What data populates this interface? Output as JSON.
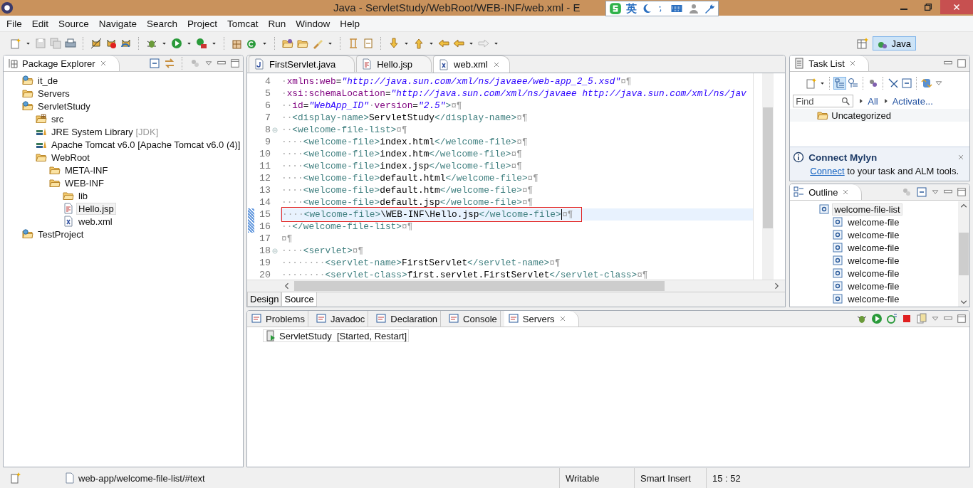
{
  "window": {
    "title": "Java - ServletStudy/WebRoot/WEB-INF/web.xml - E"
  },
  "input_method": {
    "mode": "英"
  },
  "menu": [
    "File",
    "Edit",
    "Source",
    "Navigate",
    "Search",
    "Project",
    "Tomcat",
    "Run",
    "Window",
    "Help"
  ],
  "perspective": {
    "label": "Java",
    "selected": true
  },
  "package_explorer": {
    "title": "Package Explorer",
    "items": [
      {
        "label": "it_de",
        "kind": "project",
        "selected": false
      },
      {
        "label": "Servers",
        "kind": "folder",
        "selected": false
      },
      {
        "label": "ServletStudy",
        "kind": "project",
        "selected": false,
        "children": [
          {
            "label": "src",
            "kind": "source",
            "selected": false
          },
          {
            "label": "JRE System Library",
            "decoration": "[JDK]",
            "kind": "library",
            "selected": false
          },
          {
            "label": "Apache Tomcat v6.0 [Apache Tomcat v6.0 (4)]",
            "kind": "library",
            "selected": false
          },
          {
            "label": "WebRoot",
            "kind": "folder",
            "selected": false,
            "children": [
              {
                "label": "META-INF",
                "kind": "folder",
                "selected": false
              },
              {
                "label": "WEB-INF",
                "kind": "folder",
                "selected": false,
                "children": [
                  {
                    "label": "lib",
                    "kind": "folder",
                    "selected": false
                  },
                  {
                    "label": "Hello.jsp",
                    "kind": "jsp",
                    "selected": true
                  },
                  {
                    "label": "web.xml",
                    "kind": "xml",
                    "selected": false
                  }
                ]
              }
            ]
          }
        ]
      },
      {
        "label": "TestProject",
        "kind": "project",
        "selected": false
      }
    ]
  },
  "editor": {
    "tabs": [
      {
        "label": "FirstServlet.java",
        "kind": "java",
        "selected": false
      },
      {
        "label": "Hello.jsp",
        "kind": "jsp",
        "selected": false
      },
      {
        "label": "web.xml",
        "kind": "xml",
        "selected": true
      }
    ],
    "lines": [
      {
        "number": "4",
        "foldable": false,
        "changed": false,
        "current": false,
        "boxed": false,
        "segments": [
          {
            "kind": "ws",
            "text": "·"
          },
          {
            "kind": "attr",
            "text": "xmlns:web"
          },
          {
            "kind": "plain",
            "text": "="
          },
          {
            "kind": "value",
            "text": "\"http://java.sun.com/xml/ns/javaee/web-app_2_5.xsd\""
          },
          {
            "kind": "mark",
            "text": "¤¶"
          }
        ]
      },
      {
        "number": "5",
        "foldable": false,
        "changed": false,
        "current": false,
        "boxed": false,
        "segments": [
          {
            "kind": "ws",
            "text": "·"
          },
          {
            "kind": "attr",
            "text": "xsi:schemaLocation"
          },
          {
            "kind": "plain",
            "text": "="
          },
          {
            "kind": "value",
            "text": "\"http://java.sun.com/xml/ns/javaee http://java.sun.com/xml/ns/jav"
          }
        ]
      },
      {
        "number": "6",
        "foldable": false,
        "changed": false,
        "current": false,
        "boxed": false,
        "segments": [
          {
            "kind": "ws",
            "text": "··"
          },
          {
            "kind": "attr",
            "text": "id"
          },
          {
            "kind": "plain",
            "text": "="
          },
          {
            "kind": "value",
            "text": "\"WebApp_ID\""
          },
          {
            "kind": "ws",
            "text": "·"
          },
          {
            "kind": "attr",
            "text": "version"
          },
          {
            "kind": "plain",
            "text": "="
          },
          {
            "kind": "value",
            "text": "\"2.5\""
          },
          {
            "kind": "tag",
            "text": ">"
          },
          {
            "kind": "mark",
            "text": "¤¶"
          }
        ]
      },
      {
        "number": "7",
        "foldable": false,
        "changed": false,
        "current": false,
        "boxed": false,
        "segments": [
          {
            "kind": "ws",
            "text": "··"
          },
          {
            "kind": "tag",
            "text": "<display-name>"
          },
          {
            "kind": "plain",
            "text": "ServletStudy"
          },
          {
            "kind": "tag",
            "text": "</display-name>"
          },
          {
            "kind": "mark",
            "text": "¤¶"
          }
        ]
      },
      {
        "number": "8",
        "foldable": true,
        "changed": false,
        "current": false,
        "boxed": false,
        "segments": [
          {
            "kind": "ws",
            "text": "··"
          },
          {
            "kind": "tag",
            "text": "<welcome-file-list>"
          },
          {
            "kind": "mark",
            "text": "¤¶"
          }
        ]
      },
      {
        "number": "9",
        "foldable": false,
        "changed": false,
        "current": false,
        "boxed": false,
        "segments": [
          {
            "kind": "ws",
            "text": "····"
          },
          {
            "kind": "tag",
            "text": "<welcome-file>"
          },
          {
            "kind": "plain",
            "text": "index.html"
          },
          {
            "kind": "tag",
            "text": "</welcome-file>"
          },
          {
            "kind": "mark",
            "text": "¤¶"
          }
        ]
      },
      {
        "number": "10",
        "foldable": false,
        "changed": false,
        "current": false,
        "boxed": false,
        "segments": [
          {
            "kind": "ws",
            "text": "····"
          },
          {
            "kind": "tag",
            "text": "<welcome-file>"
          },
          {
            "kind": "plain",
            "text": "index.htm"
          },
          {
            "kind": "tag",
            "text": "</welcome-file>"
          },
          {
            "kind": "mark",
            "text": "¤¶"
          }
        ]
      },
      {
        "number": "11",
        "foldable": false,
        "changed": false,
        "current": false,
        "boxed": false,
        "segments": [
          {
            "kind": "ws",
            "text": "····"
          },
          {
            "kind": "tag",
            "text": "<welcome-file>"
          },
          {
            "kind": "plain",
            "text": "index.jsp"
          },
          {
            "kind": "tag",
            "text": "</welcome-file>"
          },
          {
            "kind": "mark",
            "text": "¤¶"
          }
        ]
      },
      {
        "number": "12",
        "foldable": false,
        "changed": false,
        "current": false,
        "boxed": false,
        "segments": [
          {
            "kind": "ws",
            "text": "····"
          },
          {
            "kind": "tag",
            "text": "<welcome-file>"
          },
          {
            "kind": "plain",
            "text": "default.html"
          },
          {
            "kind": "tag",
            "text": "</welcome-file>"
          },
          {
            "kind": "mark",
            "text": "¤¶"
          }
        ]
      },
      {
        "number": "13",
        "foldable": false,
        "changed": false,
        "current": false,
        "boxed": false,
        "segments": [
          {
            "kind": "ws",
            "text": "····"
          },
          {
            "kind": "tag",
            "text": "<welcome-file>"
          },
          {
            "kind": "plain",
            "text": "default.htm"
          },
          {
            "kind": "tag",
            "text": "</welcome-file>"
          },
          {
            "kind": "mark",
            "text": "¤¶"
          }
        ]
      },
      {
        "number": "14",
        "foldable": false,
        "changed": false,
        "current": false,
        "boxed": false,
        "segments": [
          {
            "kind": "ws",
            "text": "····"
          },
          {
            "kind": "tag",
            "text": "<welcome-file>"
          },
          {
            "kind": "plain",
            "text": "default.jsp"
          },
          {
            "kind": "tag",
            "text": "</welcome-file>"
          },
          {
            "kind": "mark",
            "text": "¤¶"
          }
        ]
      },
      {
        "number": "15",
        "foldable": false,
        "changed": true,
        "current": true,
        "boxed": true,
        "segments": [
          {
            "kind": "ws",
            "text": "····"
          },
          {
            "kind": "tag",
            "text": "<welcome-file>"
          },
          {
            "kind": "plain",
            "text": "\\WEB-INF\\Hello.jsp"
          },
          {
            "kind": "tag",
            "text": "</welcome-file>"
          },
          {
            "kind": "caret"
          },
          {
            "kind": "mark",
            "text": "¤¶"
          }
        ]
      },
      {
        "number": "16",
        "foldable": false,
        "changed": true,
        "current": false,
        "boxed": false,
        "segments": [
          {
            "kind": "ws",
            "text": "··"
          },
          {
            "kind": "tag",
            "text": "</welcome-file-list>"
          },
          {
            "kind": "mark",
            "text": "¤¶"
          }
        ]
      },
      {
        "number": "17",
        "foldable": false,
        "changed": false,
        "current": false,
        "boxed": false,
        "segments": [
          {
            "kind": "mark",
            "text": "¤¶"
          }
        ]
      },
      {
        "number": "18",
        "foldable": true,
        "changed": false,
        "current": false,
        "boxed": false,
        "segments": [
          {
            "kind": "ws",
            "text": "····"
          },
          {
            "kind": "tag",
            "text": "<servlet>"
          },
          {
            "kind": "mark",
            "text": "¤¶"
          }
        ]
      },
      {
        "number": "19",
        "foldable": false,
        "changed": false,
        "current": false,
        "boxed": false,
        "segments": [
          {
            "kind": "ws",
            "text": "········"
          },
          {
            "kind": "tag",
            "text": "<servlet-name>"
          },
          {
            "kind": "plain",
            "text": "FirstServlet"
          },
          {
            "kind": "tag",
            "text": "</servlet-name>"
          },
          {
            "kind": "mark",
            "text": "¤¶"
          }
        ]
      },
      {
        "number": "20",
        "foldable": false,
        "changed": false,
        "current": false,
        "boxed": false,
        "segments": [
          {
            "kind": "ws",
            "text": "········"
          },
          {
            "kind": "tag",
            "text": "<servlet-class>"
          },
          {
            "kind": "plain",
            "text": "first.servlet.FirstServlet"
          },
          {
            "kind": "tag",
            "text": "</servlet-class>"
          },
          {
            "kind": "mark",
            "text": "¤¶"
          }
        ]
      }
    ],
    "bottom_tabs": [
      {
        "label": "Design",
        "selected": false
      },
      {
        "label": "Source",
        "selected": true
      }
    ]
  },
  "task_list": {
    "title": "Task List",
    "find": {
      "placeholder": "Find"
    },
    "links": [
      "All",
      "Activate..."
    ],
    "category": "Uncategorized"
  },
  "connect_mylyn": {
    "title": "Connect Mylyn",
    "link": "Connect",
    "text": " to your task and ALM tools."
  },
  "outline": {
    "title": "Outline",
    "items": [
      {
        "label": "welcome-file-list",
        "selected": true,
        "children": [
          {
            "label": "welcome-file",
            "selected": false
          },
          {
            "label": "welcome-file",
            "selected": false
          },
          {
            "label": "welcome-file",
            "selected": false
          },
          {
            "label": "welcome-file",
            "selected": false
          },
          {
            "label": "welcome-file",
            "selected": false
          },
          {
            "label": "welcome-file",
            "selected": false
          },
          {
            "label": "welcome-file",
            "selected": false
          }
        ]
      }
    ]
  },
  "bottom_panel": {
    "tabs": [
      {
        "label": "Problems",
        "selected": false
      },
      {
        "label": "Javadoc",
        "selected": false
      },
      {
        "label": "Declaration",
        "selected": false
      },
      {
        "label": "Console",
        "selected": false
      },
      {
        "label": "Servers",
        "selected": true
      }
    ],
    "servers": [
      {
        "name": "ServletStudy",
        "state": "[Started, Restart]"
      }
    ]
  },
  "status_bar": {
    "path": "web-app/welcome-file-list/#text",
    "mode": "Writable",
    "insert": "Smart Insert",
    "position": "15 : 52"
  }
}
